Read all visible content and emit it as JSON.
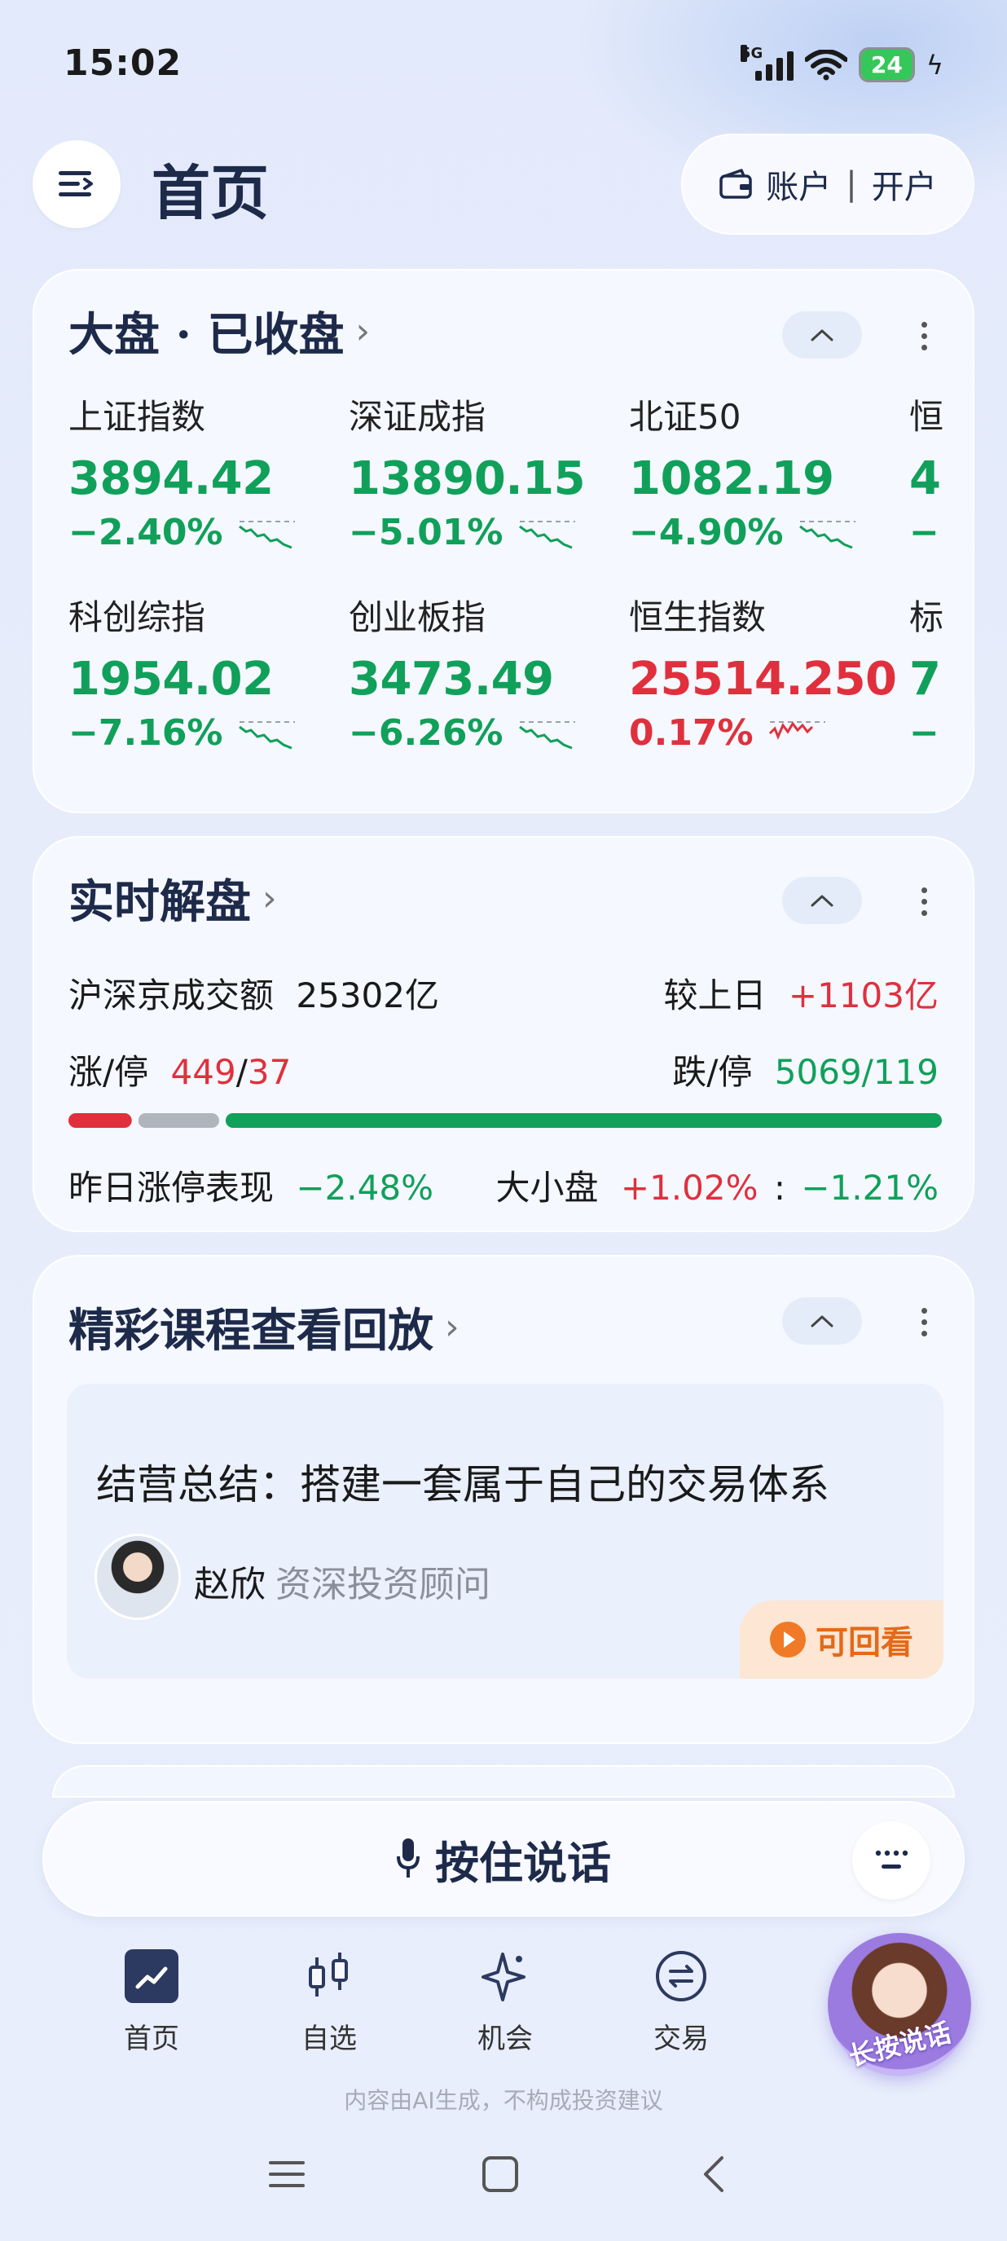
{
  "status": {
    "time": "15:02",
    "network": "5G",
    "battery": "24"
  },
  "header": {
    "title": "首页",
    "account": "账户",
    "separator": "|",
    "open_account": "开户"
  },
  "market": {
    "title": "大盘 · 已收盘",
    "chevron": "›",
    "indices": [
      {
        "name": "上证指数",
        "value": "3894.42",
        "change": "−2.40%",
        "trend": "down"
      },
      {
        "name": "深证成指",
        "value": "13890.15",
        "change": "−5.01%",
        "trend": "down"
      },
      {
        "name": "北证50",
        "value": "1082.19",
        "change": "−4.90%",
        "trend": "down"
      },
      {
        "name": "恒",
        "value": "4",
        "change": "−",
        "trend": "down"
      },
      {
        "name": "科创综指",
        "value": "1954.02",
        "change": "−7.16%",
        "trend": "down"
      },
      {
        "name": "创业板指",
        "value": "3473.49",
        "change": "−6.26%",
        "trend": "down"
      },
      {
        "name": "恒生指数",
        "value": "25514.250",
        "change": "0.17%",
        "trend": "up"
      },
      {
        "name": "标",
        "value": "7",
        "change": "−",
        "trend": "down"
      }
    ]
  },
  "realtime": {
    "title": "实时解盘",
    "chevron": "›",
    "turnover_label": "沪深京成交额",
    "turnover_value": "25302亿",
    "vs_prev_label": "较上日",
    "vs_prev_value": "+1103亿",
    "up_label": "涨/停",
    "up_count": "449",
    "slash": "/",
    "up_limit": "37",
    "down_label": "跌/停",
    "down_value": "5069/119",
    "breadth": {
      "up_fraction": 0.08,
      "flat_fraction": 0.1,
      "down_fraction": 0.82
    },
    "prev_limit_label": "昨日涨停表现",
    "prev_limit_value": "−2.48%",
    "size_label": "大小盘",
    "large_cap": "+1.02%",
    "colon": ":",
    "small_cap": "−1.21%"
  },
  "course": {
    "title": "精彩课程查看回放",
    "chevron": "›",
    "lesson_title": "结营总结：搭建一套属于自己的交易体系",
    "teacher_name": "赵欣",
    "teacher_role": "资深投资顾问",
    "badge": "可回看"
  },
  "voice": {
    "label": "按住说话"
  },
  "nav": {
    "items": [
      {
        "label": "首页"
      },
      {
        "label": "自选"
      },
      {
        "label": "机会"
      },
      {
        "label": "交易"
      }
    ],
    "ai_label": "长按说话"
  },
  "disclaimer": "内容由AI生成，不构成投资建议",
  "colors": {
    "up": "#e0303d",
    "down": "#10a05a",
    "accent": "#1e2a4a",
    "flat": "#b0b4bd"
  }
}
